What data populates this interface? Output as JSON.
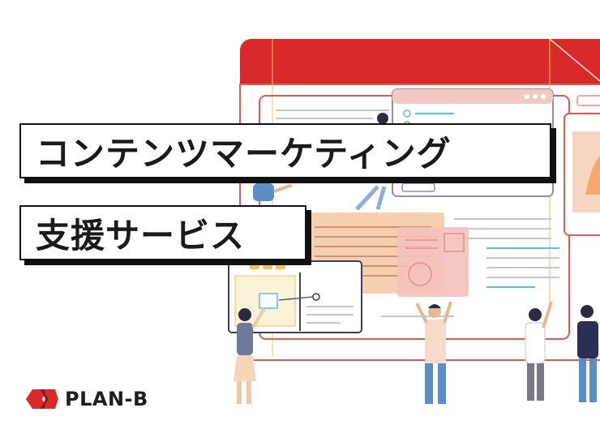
{
  "headline": {
    "line1": "コンテンツマーケティング",
    "line2": "支援サービス"
  },
  "brand": {
    "name": "PLAN-B",
    "logo_icon": "plan-b-logo-icon"
  },
  "colors": {
    "accent_red": "#d82a2a",
    "light_pink": "#f4c9c4",
    "peach": "#f6cfb0",
    "text_dark": "#1a1a1a"
  },
  "illustration": {
    "icon": "website-building-illustration"
  }
}
